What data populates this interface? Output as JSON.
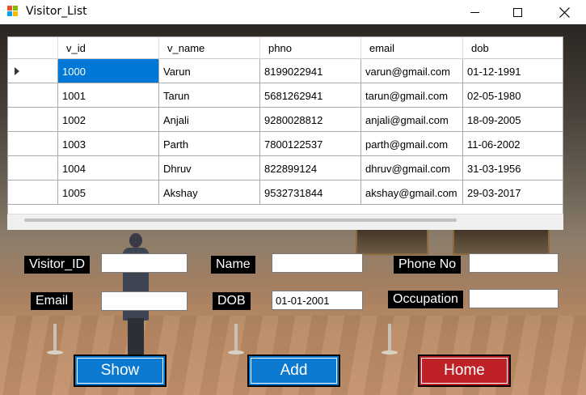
{
  "window": {
    "title": "Visitor_List"
  },
  "grid": {
    "columns": [
      "v_id",
      "v_name",
      "phno",
      "email",
      "dob"
    ],
    "rows": [
      [
        "1000",
        "Varun",
        "8199022941",
        "varun@gmail.com",
        "01-12-1991"
      ],
      [
        "1001",
        "Tarun",
        "5681262941",
        "tarun@gmail.com",
        "02-05-1980"
      ],
      [
        "1002",
        "Anjali",
        "9280028812",
        "anjali@gmail.com",
        "18-09-2005"
      ],
      [
        "1003",
        "Parth",
        "7800122537",
        "parth@gmail.com",
        "11-06-2002"
      ],
      [
        "1004",
        "Dhruv",
        "822899124",
        "dhruv@gmail.com",
        "31-03-1956"
      ],
      [
        "1005",
        "Akshay",
        "9532731844",
        "akshay@gmail.com",
        "29-03-2017"
      ]
    ],
    "selected_row": 0
  },
  "form": {
    "visitor_id_label": "Visitor_ID",
    "name_label": "Name",
    "phone_label": "Phone No",
    "email_label": "Email",
    "dob_label": "DOB",
    "occupation_label": "Occupation",
    "visitor_id_value": "",
    "name_value": "",
    "phone_value": "",
    "email_value": "",
    "dob_value": "01-01-2001",
    "occupation_value": ""
  },
  "buttons": {
    "show": "Show",
    "add": "Add",
    "home": "Home"
  },
  "colors": {
    "show": "#0b79d0",
    "add": "#0b79d0",
    "home": "#bf2226",
    "selection": "#0078d7"
  },
  "icons": {
    "app": "app-icon",
    "minimize": "minimize-icon",
    "maximize": "maximize-icon",
    "close": "close-icon"
  }
}
